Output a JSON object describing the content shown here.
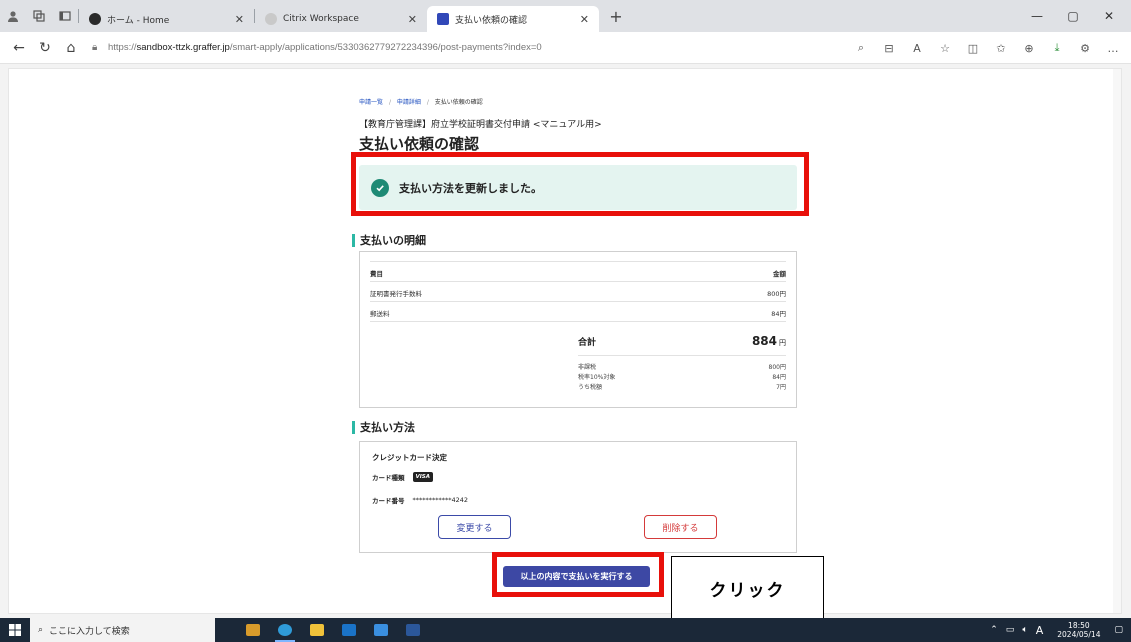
{
  "browser": {
    "tabs": [
      {
        "title": "ホーム - Home"
      },
      {
        "title": "Citrix Workspace"
      },
      {
        "title": "支払い依頼の確認"
      }
    ],
    "url_prefix": "https://",
    "url_host": "sandbox-ttzk.graffer.jp",
    "url_path": "/smart-apply/applications/5330362779272234396/post-payments?index=0"
  },
  "page": {
    "breadcrumb": [
      "申請一覧",
      "申請詳細",
      "支払い依頼の確認"
    ],
    "subtitle": "【教育庁管理課】府立学校証明書交付申請 <マニュアル用>",
    "title": "支払い依頼の確認",
    "alert": "支払い方法を更新しました。"
  },
  "details": {
    "heading": "支払いの明細",
    "col_item": "費目",
    "col_amount": "金額",
    "rows": [
      {
        "item": "証明書発行手数料",
        "amount": "800円"
      },
      {
        "item": "郵送料",
        "amount": "84円"
      }
    ],
    "total_label": "合計",
    "total_value": "884",
    "total_unit": "円",
    "tax": [
      {
        "label": "非課税",
        "amount": "800円"
      },
      {
        "label": "税率10%対象",
        "amount": "84円"
      },
      {
        "label": "うち税額",
        "amount": "7円"
      }
    ]
  },
  "payment": {
    "heading": "支払い方法",
    "method": "クレジットカード決定",
    "card_brand_label": "カード種類",
    "card_brand": "VISA",
    "card_number_label": "カード番号",
    "card_number": "************4242",
    "change_button": "変更する",
    "delete_button": "削除する"
  },
  "execute_button": "以上の内容で支払いを実行する",
  "annotation_callout": "クリック",
  "taskbar": {
    "search_placeholder": "ここに入力して検索",
    "time": "18:50",
    "date": "2024/05/14"
  },
  "colors": {
    "accent_teal": "#2cb8a5",
    "alert_bg": "#e4f4f0",
    "primary_button": "#3d48a4",
    "highlight_red": "#e8100a",
    "delete_red": "#d43a3a"
  }
}
